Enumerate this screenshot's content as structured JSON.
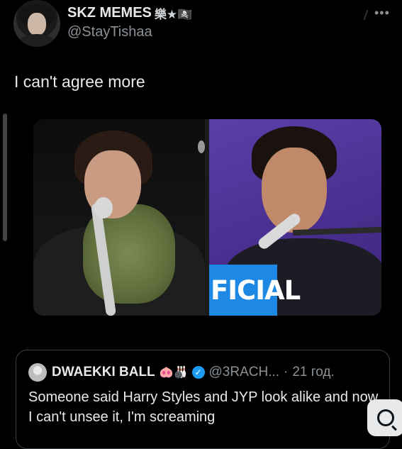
{
  "author": {
    "display_name": "SKZ MEMES",
    "name_emoji": "樂★🏴‍☠️",
    "handle": "@StayTishaa"
  },
  "tweet": {
    "text": "I can't agree more"
  },
  "media": {
    "right_overlay_text": "FICIAL"
  },
  "quoted": {
    "display_name": "DWAEKKI BALL",
    "name_emoji": "🐽🎳",
    "handle": "@3RACH...",
    "separator": "·",
    "time": "21 год.",
    "text": "Someone said Harry Styles and JYP look alike and now I can't unsee it, I'm screaming"
  },
  "icons": {
    "more": "more-horizontal-icon",
    "verified": "verified-badge-icon",
    "fab": "search-refresh-icon"
  },
  "colors": {
    "background": "#000000",
    "text": "#e7e9ea",
    "muted": "#8b9196",
    "verified": "#1d9bf0",
    "overlay": "#1e88e5"
  }
}
